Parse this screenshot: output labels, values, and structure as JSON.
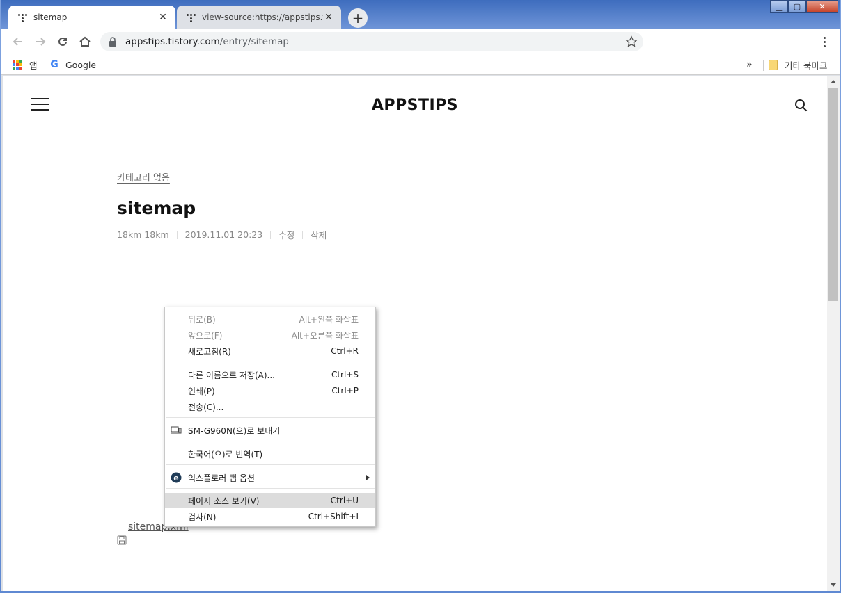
{
  "browser": {
    "tabs": [
      {
        "title": "sitemap",
        "active": true
      },
      {
        "title": "view-source:https://appstips.tistory.com/sitemap.xml",
        "active": false
      }
    ],
    "new_tab_symbol": "+",
    "close_symbol": "✕",
    "url": {
      "host": "appstips.tistory.com",
      "path": "/entry/sitemap"
    },
    "bookmarks": {
      "apps_label": "앱",
      "google_label": "Google",
      "overflow_label": "»",
      "other_label": "기타 북마크"
    }
  },
  "page": {
    "site_title": "APPSTIPS",
    "category": "카테고리 없음",
    "post_title": "sitemap",
    "author": "18km 18km",
    "date": "2019.11.01 20:23",
    "edit_label": "수정",
    "delete_label": "삭제",
    "attachment": "sitemap.xml"
  },
  "context_menu": {
    "items": [
      {
        "label": "뒤로(B)",
        "shortcut": "Alt+왼쪽 화살표",
        "disabled": true
      },
      {
        "label": "앞으로(F)",
        "shortcut": "Alt+오른쪽 화살표",
        "disabled": true
      },
      {
        "label": "새로고침(R)",
        "shortcut": "Ctrl+R"
      },
      {
        "label": "다른 이름으로 저장(A)...",
        "shortcut": "Ctrl+S"
      },
      {
        "label": "인쇄(P)",
        "shortcut": "Ctrl+P"
      },
      {
        "label": "전송(C)...",
        "shortcut": ""
      },
      {
        "label": "SM-G960N(으)로 보내기",
        "shortcut": "",
        "icon": "devices-icon"
      },
      {
        "label": "한국어(으)로 번역(T)",
        "shortcut": ""
      },
      {
        "label": "익스플로러 탭 옵션",
        "shortcut": "",
        "icon": "ie-tab-icon",
        "submenu": true
      },
      {
        "label": "페이지 소스 보기(V)",
        "shortcut": "Ctrl+U",
        "highlighted": true
      },
      {
        "label": "검사(N)",
        "shortcut": "Ctrl+Shift+I"
      }
    ]
  },
  "colors": {
    "accent": "#4285f4",
    "highlight": "#dcdcdc"
  }
}
